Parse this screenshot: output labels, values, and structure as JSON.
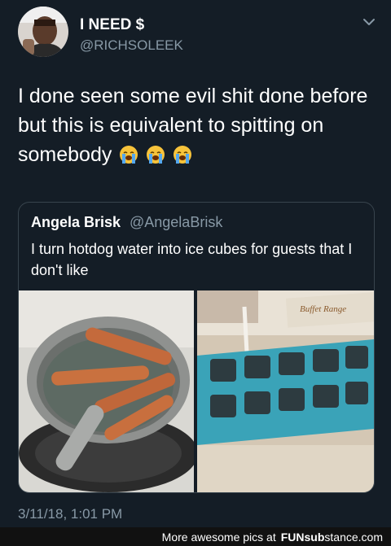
{
  "tweet": {
    "display_name": "I NEED $",
    "handle": "@RICHSOLEEK",
    "text": "I done seen some evil shit done before but this is equivalent to spitting on somebody",
    "emojis": [
      "crying-face",
      "crying-face",
      "crying-face"
    ],
    "timestamp": "3/11/18, 1:01 PM"
  },
  "quoted_tweet": {
    "display_name": "Angela Brisk",
    "handle": "@AngelaBrisk",
    "text": "I turn hotdog water into ice cubes for guests that I don't like",
    "images": [
      "hotdogs-boiling-in-pot",
      "ice-cube-tray"
    ],
    "tray_label": "Buffet Range"
  },
  "footer": {
    "prefix": "More awesome pics at",
    "brand_main": "FUNsub",
    "brand_rest": "stance.com"
  },
  "colors": {
    "background": "#141d26",
    "secondary_text": "#8899a6",
    "border": "#38444d"
  }
}
